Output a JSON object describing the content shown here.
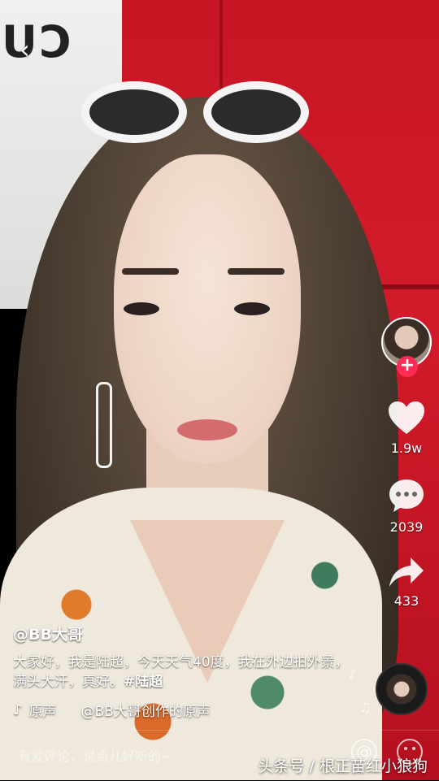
{
  "actions": {
    "likes": "1.9w",
    "comments": "2039",
    "shares": "433"
  },
  "video": {
    "username": "@BB大哥",
    "description": "大家好，我是陆超，今天天气40度，我在外边拍外景，满头大汗，真好。",
    "hashtag": "#陆超",
    "music_label": "原声",
    "music_title": "@BB大哥创作的原声"
  },
  "comment": {
    "placeholder": "有爱评论，说点儿好听的~"
  },
  "watermark": "头条号 / 根正苗红小狼狗",
  "background_sign": "CU",
  "colors": {
    "accent": "#fe2c55",
    "background": "#c81624"
  },
  "icons": {
    "back": "chevron-left-icon",
    "follow": "plus-icon",
    "like": "heart-icon",
    "comment": "speech-bubble-icon",
    "share": "share-arrow-icon",
    "music": "music-note-icon",
    "mention": "at-sign-icon",
    "emoji": "smiley-icon"
  }
}
